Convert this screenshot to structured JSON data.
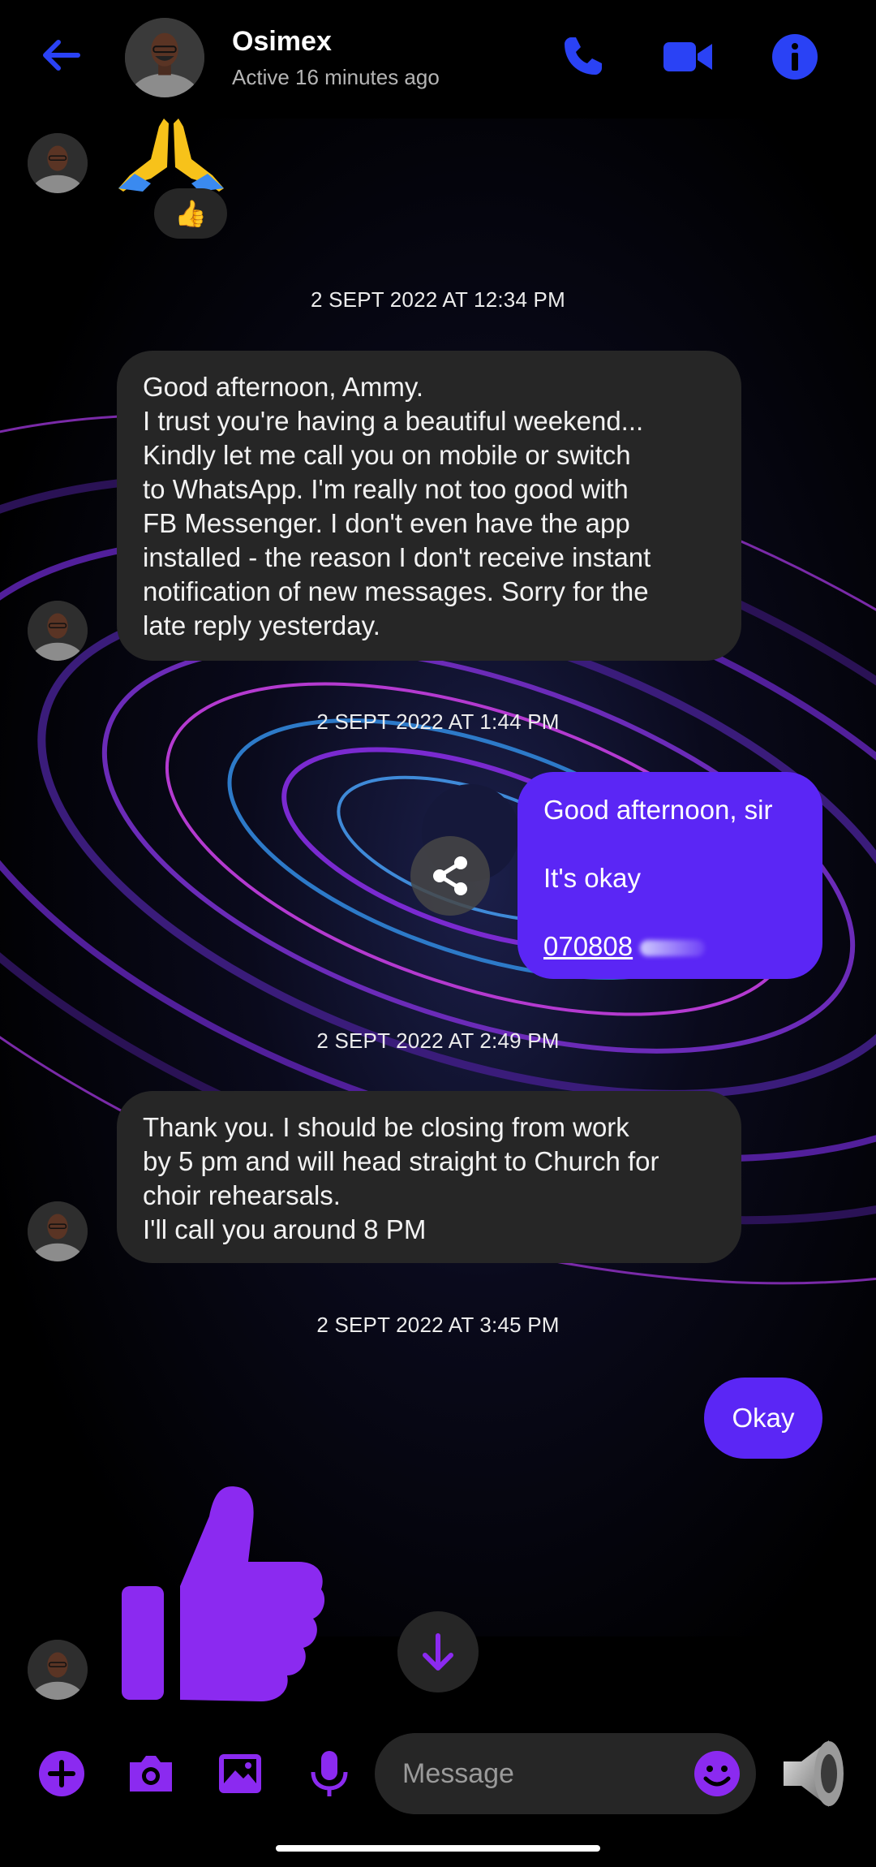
{
  "header": {
    "contact_name": "Osimex",
    "status": "Active 16 minutes ago"
  },
  "colors": {
    "accent": "#5b26f5",
    "purple": "#8b2af0",
    "bubble_in": "#262626",
    "background": "#000000"
  },
  "icons": {
    "back": "arrow-left-icon",
    "call": "phone-icon",
    "video": "video-camera-icon",
    "info": "info-icon",
    "share": "share-icon",
    "scroll_down": "arrow-down-icon",
    "add": "plus-circle-icon",
    "camera": "camera-icon",
    "gallery": "image-icon",
    "mic": "microphone-icon",
    "emoji": "smiley-icon",
    "speaker": "speaker-icon"
  },
  "messages": {
    "first_emoji": "🙏",
    "first_reaction": "👍",
    "ts1": "2 SEPT 2022 AT 12:34 PM",
    "msg1": "Good afternoon, Ammy.\nI trust you're having a beautiful weekend...\nKindly let me call you on mobile or switch\nto WhatsApp. I'm really not too good with\nFB Messenger. I don't even have the app\ninstalled - the reason I don't receive instant\nnotification of new messages. Sorry for the\nlate reply yesterday.",
    "ts2": "2 SEPT 2022 AT 1:44 PM",
    "out1_line1": "Good afternoon, sir",
    "out1_line2": "It's okay",
    "out1_phone": "070808",
    "ts3": "2 SEPT 2022 AT 2:49 PM",
    "msg2": "Thank you. I should be closing from work\nby 5 pm and will head straight to Church for\nchoir rehearsals.\nI'll call you around 8 PM",
    "ts4": "2 SEPT 2022 AT 3:45 PM",
    "out2": "Okay",
    "big_like": "thumbs-up-icon"
  },
  "composer": {
    "placeholder": "Message"
  }
}
